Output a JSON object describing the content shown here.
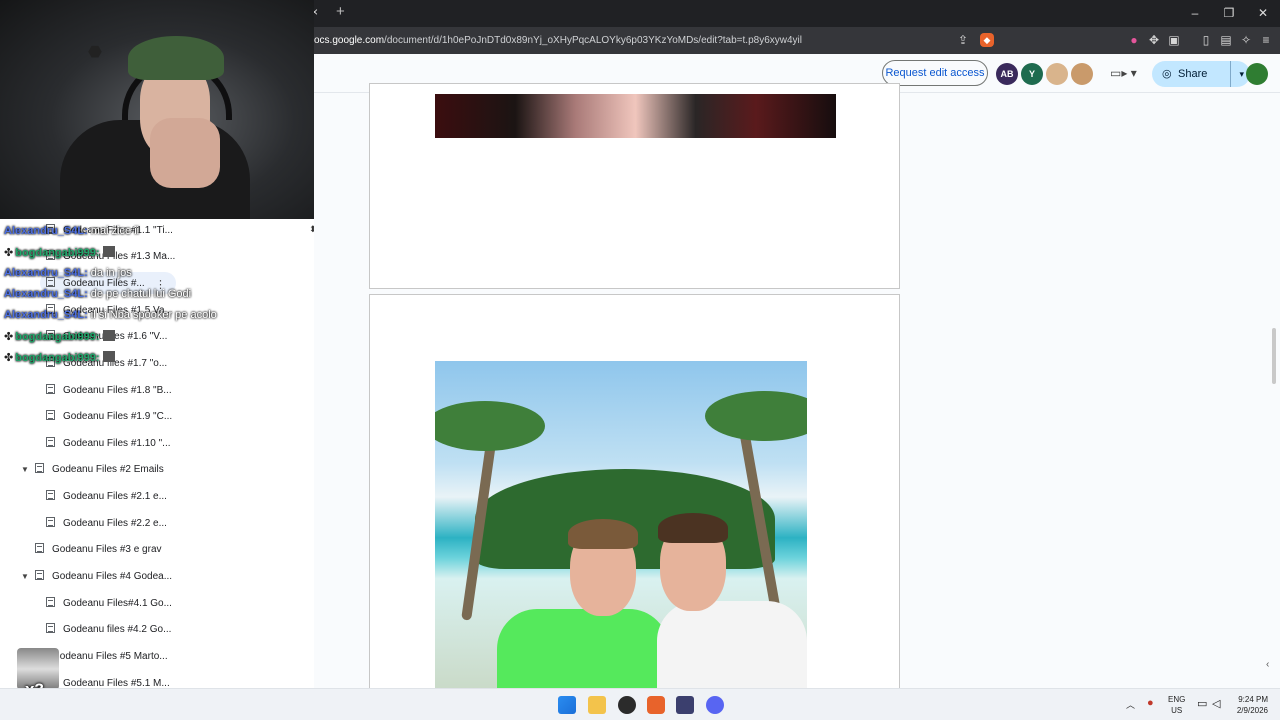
{
  "browser": {
    "tab_close": "×",
    "new_tab": "+",
    "window_controls": [
      "–",
      "❐",
      "✕"
    ],
    "url_prefix": "ocs.google.com",
    "url_path": "/document/d/1h0ePoJnDTd0x89nYj_oXHyPqcALOYky6p03YKzYoMDs/edit?tab=t.p8y6xyw4yil"
  },
  "docs_header": {
    "request_edit_label": "Request edit access",
    "share_label": "Share",
    "collaborators": [
      {
        "initials": "AB",
        "color": "#3a2a5c"
      },
      {
        "initials": "Y",
        "color": "#1e6b4f"
      },
      {
        "initials": "",
        "color": "#d9b48c"
      },
      {
        "initials": "",
        "color": "#c99a6b"
      }
    ]
  },
  "outline": {
    "items": [
      {
        "label": "Godeanu Files #1.1 \"Ti...",
        "indent": 2
      },
      {
        "label": "Godeanu Files #1.3 Ma...",
        "indent": 2
      },
      {
        "label": "Godeanu Files #...",
        "indent": 2
      },
      {
        "label": "Godeanu Files #1.5 Va...",
        "indent": 2
      },
      {
        "label": "Godeanu files #1.6 \"V...",
        "indent": 2
      },
      {
        "label": "Godeanu files #1.7 \"o...",
        "indent": 2
      },
      {
        "label": "Godeanu Files #1.8 \"B...",
        "indent": 2
      },
      {
        "label": "Godeanu Files #1.9 \"C...",
        "indent": 2
      },
      {
        "label": "Godeanu Files #1.10 \"...",
        "indent": 2
      },
      {
        "label": "Godeanu Files #2 Emails",
        "indent": 1,
        "expanded": true
      },
      {
        "label": "Godeanu Files #2.1 e...",
        "indent": 2
      },
      {
        "label": "Godeanu Files #2.2 e...",
        "indent": 2
      },
      {
        "label": "Godeanu Files #3 e grav",
        "indent": 1
      },
      {
        "label": "Godeanu Files #4 Godea...",
        "indent": 1,
        "expanded": true
      },
      {
        "label": "Godeanu Files#4.1 Go...",
        "indent": 2
      },
      {
        "label": "Godeanu files #4.2 Go...",
        "indent": 2
      },
      {
        "label": "Godeanu Files #5 Marto...",
        "indent": 1
      },
      {
        "label": "Godeanu Files #5.1 M...",
        "indent": 2
      }
    ]
  },
  "chat": [
    {
      "user": "Alexandru_S4L:",
      "msg": " mai zice ii ",
      "type": "alex"
    },
    {
      "user": "bogdangabi999:",
      "msg": "",
      "type": "bog",
      "emote": true
    },
    {
      "user": "Alexandru_S4L:",
      "msg": " da in jos",
      "type": "alex"
    },
    {
      "user": "Alexandru_S4L:",
      "msg": " de pe chatul lui Godi",
      "type": "alex"
    },
    {
      "user": "Alexandru_S4L:",
      "msg": " il si Nba spooker pe acolo",
      "type": "alex"
    },
    {
      "user": "bogdangabi999:",
      "msg": "",
      "type": "bog",
      "emote": true
    },
    {
      "user": "bogdangabi999:",
      "msg": "",
      "type": "bog",
      "emote": true
    }
  ],
  "emote_counter": "x3",
  "taskbar": {
    "lang_top": "ENG",
    "lang_bottom": "US",
    "time": "9:24 PM",
    "date": "2/9/2026"
  }
}
